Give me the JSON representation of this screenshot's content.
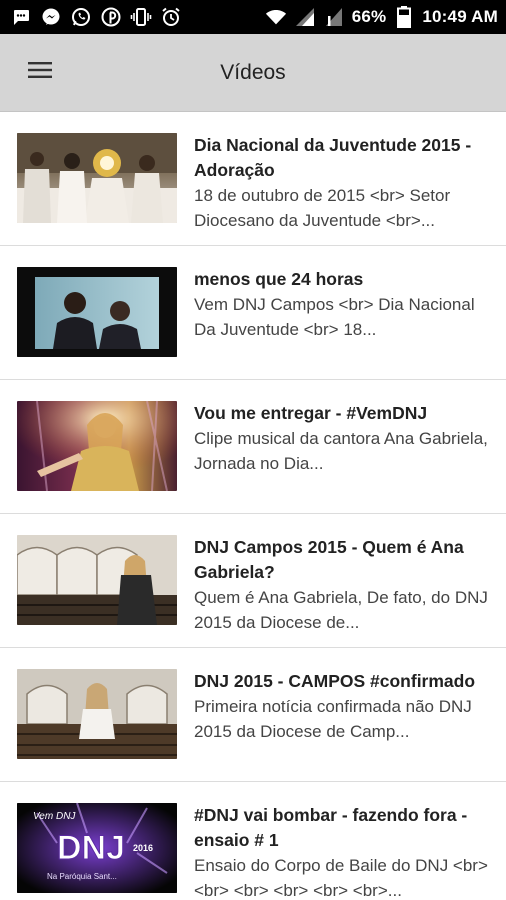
{
  "status_bar": {
    "battery_percent": "66%",
    "time": "10:49 AM",
    "left_icons": [
      "message-icon",
      "messenger-icon",
      "whatsapp-icon",
      "pinterest-icon",
      "vibrate-icon",
      "alarm-icon",
      "wifi-icon",
      "signal-icon"
    ]
  },
  "app_bar": {
    "title": "Vídeos",
    "menu_icon": "hamburger-menu-icon",
    "background": "#d5d5d5"
  },
  "videos": [
    {
      "title": "Dia Nacional da Juventude 2015 - Adoração",
      "description": "18 de outubro de 2015 <br> Setor Diocesano da Juventude <br>..."
    },
    {
      "title": "menos que 24 horas",
      "description": "Vem DNJ Campos <br> Dia Nacional Da Juventude <br> 18..."
    },
    {
      "title": "Vou me entregar - #VemDNJ",
      "description": "Clipe musical da cantora Ana Gabriela, Jornada no Dia..."
    },
    {
      "title": "DNJ Campos 2015 - Quem é Ana Gabriela?",
      "description": "Quem é Ana Gabriela, De fato, do DNJ 2015 da Diocese de..."
    },
    {
      "title": "DNJ 2015 - CAMPOS #confirmado",
      "description": "Primeira notícia confirmada não DNJ 2015 da Diocese de Camp..."
    },
    {
      "title": "#DNJ vai bombar - fazendo fora - ensaio # 1",
      "description": "Ensaio do Corpo de Baile do DNJ <br> <br> <br> <br> <br> <br>...",
      "thumbnail_text": {
        "top": "Vem DNJ",
        "main": "DNJ",
        "side": "2016",
        "bottom": "Na Paróquia Sant..."
      }
    }
  ]
}
